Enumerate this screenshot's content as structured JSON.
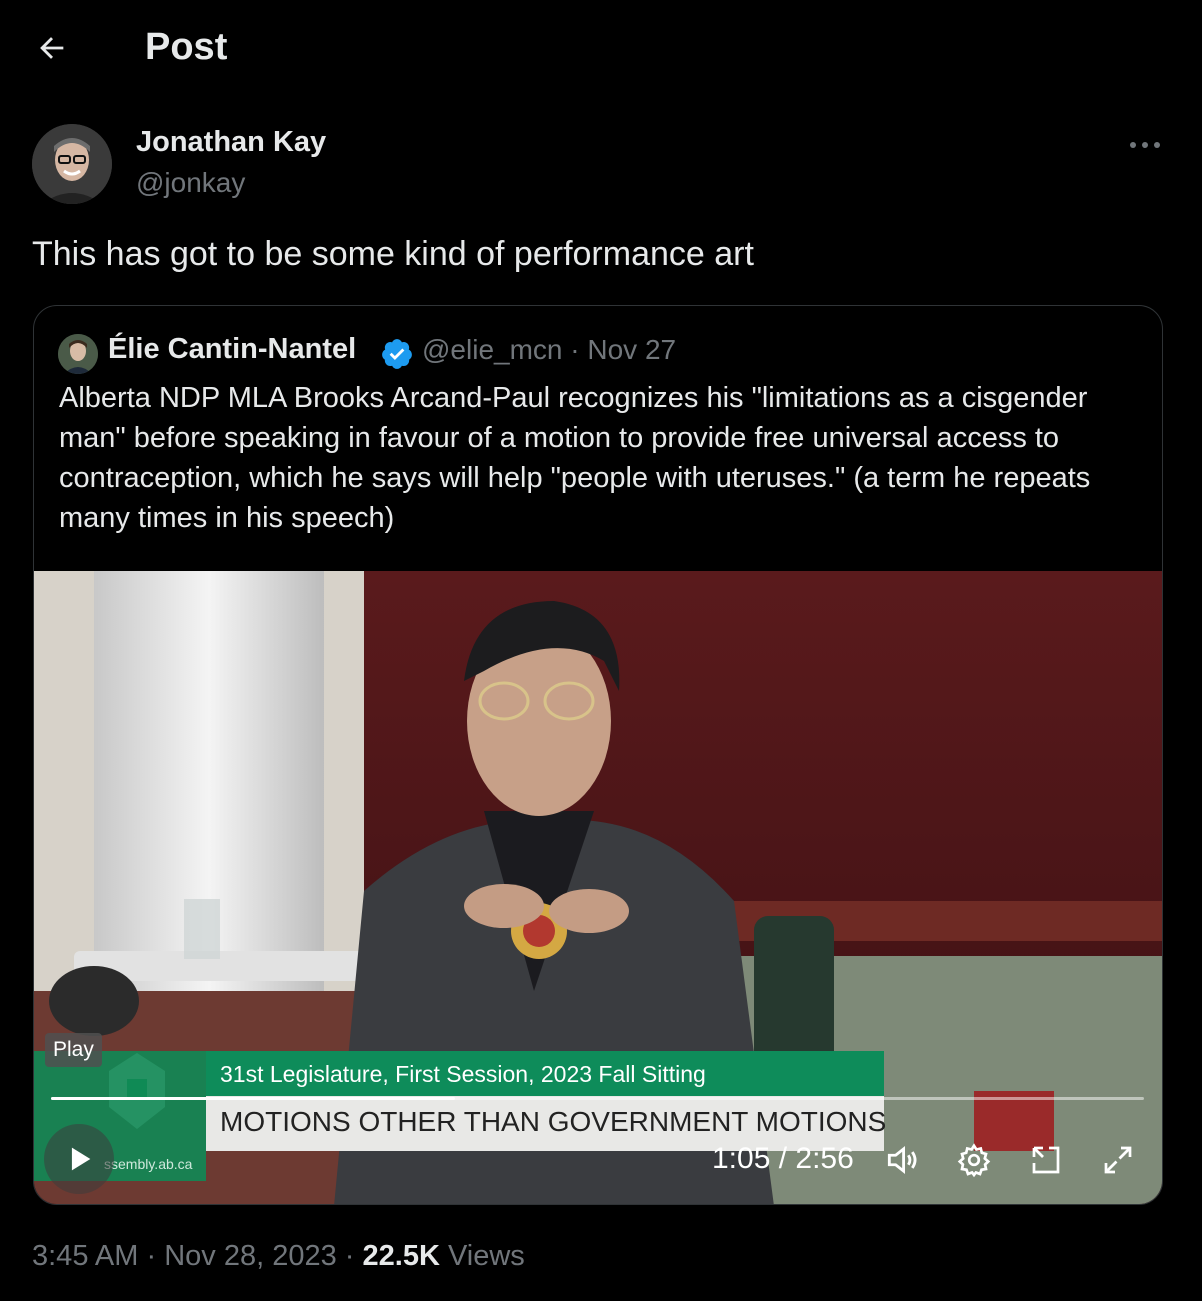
{
  "header": {
    "title": "Post"
  },
  "author": {
    "name": "Jonathan Kay",
    "handle": "@jonkay"
  },
  "tweet": {
    "text": "This has got to be some kind of performance art"
  },
  "quoted": {
    "name": "Élie Cantin-Nantel",
    "handle": "@elie_mcn",
    "separator": "·",
    "date": "Nov 27",
    "text": "Alberta NDP MLA Brooks Arcand-Paul recognizes his \"limitations as a cisgender man\" before speaking in favour of a motion to provide free universal access to contraception, which he says will help \"people with uteruses.\" (a term he repeats many times in his speech)"
  },
  "video": {
    "badge": "Play",
    "lower_third_line1": "31st Legislature, First Session, 2023 Fall Sitting",
    "lower_third_line2": "MOTIONS OTHER THAN GOVERNMENT MOTIONS",
    "crest_site": "ssembly.ab.ca",
    "time": "1:05 / 2:56",
    "progress": 0.37
  },
  "footer": {
    "time": "3:45 AM",
    "sep1": "·",
    "date": "Nov 28, 2023",
    "sep2": "·",
    "views_count": "22.5K",
    "views_label": "Views"
  },
  "colors": {
    "background": "#000000",
    "text": "#e7e9ea",
    "muted": "#71767b",
    "verified": "#1d9bf0",
    "border": "#2f3336"
  }
}
